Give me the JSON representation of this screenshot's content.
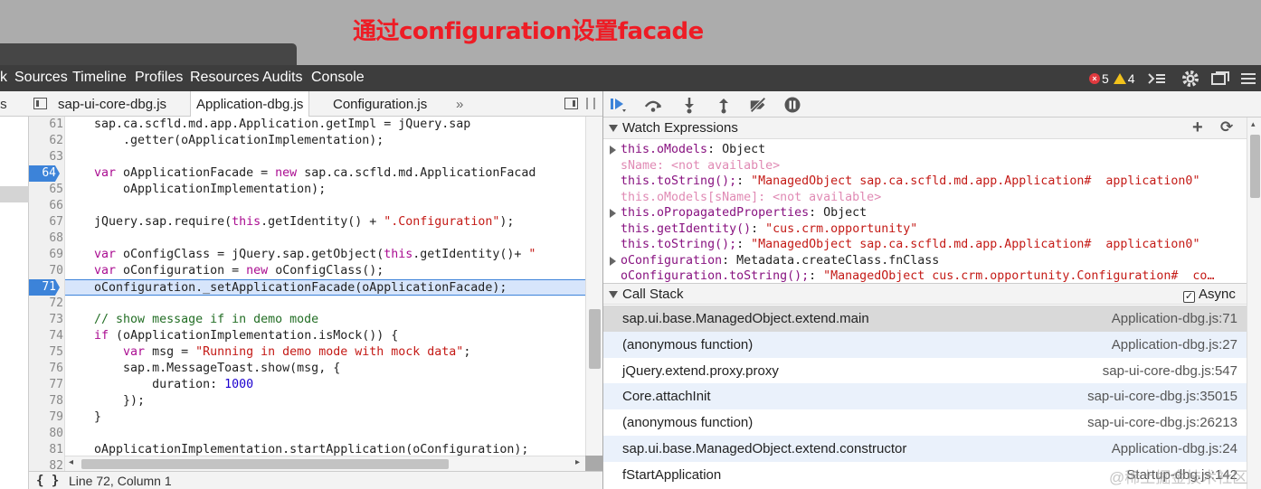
{
  "annotation": "通过configuration设置facade",
  "panel_tabs": [
    "k",
    "Sources",
    "Timeline",
    "Profiles",
    "Resources",
    "Audits",
    "Console"
  ],
  "counts": {
    "errors": "5",
    "warnings": "4"
  },
  "navigator": {
    "label": "ts"
  },
  "editor_tabs": [
    "sap-ui-core-dbg.js",
    "Application-dbg.js",
    "Configuration.js"
  ],
  "active_tab": "Application-dbg.js",
  "more_tabs": "»",
  "breakpoints": [
    "64",
    "71"
  ],
  "current_line": "71",
  "code_lines": [
    {
      "n": "61",
      "parts": [
        [
          "",
          "    sap.ca.scfld.md.app.Application.getImpl = jQuery.sap"
        ]
      ]
    },
    {
      "n": "62",
      "parts": [
        [
          "",
          "        .getter(oApplicationImplementation);"
        ]
      ]
    },
    {
      "n": "63",
      "parts": [
        [
          "",
          ""
        ]
      ]
    },
    {
      "n": "64",
      "parts": [
        [
          "kw",
          "    var"
        ],
        [
          "",
          " oApplicationFacade = "
        ],
        [
          "kw",
          "new"
        ],
        [
          "",
          " sap.ca.scfld.md.ApplicationFacad"
        ]
      ]
    },
    {
      "n": "65",
      "parts": [
        [
          "",
          "        oApplicationImplementation);"
        ]
      ]
    },
    {
      "n": "66",
      "parts": [
        [
          "",
          ""
        ]
      ]
    },
    {
      "n": "67",
      "parts": [
        [
          "",
          "    jQuery.sap.require("
        ],
        [
          "kw",
          "this"
        ],
        [
          "",
          ".getIdentity() + "
        ],
        [
          "str",
          "\".Configuration\""
        ],
        [
          "",
          ");"
        ]
      ]
    },
    {
      "n": "68",
      "parts": [
        [
          "",
          ""
        ]
      ]
    },
    {
      "n": "69",
      "parts": [
        [
          "kw",
          "    var"
        ],
        [
          "",
          " oConfigClass = jQuery.sap.getObject("
        ],
        [
          "kw",
          "this"
        ],
        [
          "",
          ".getIdentity()+ "
        ],
        [
          "str",
          "\""
        ]
      ]
    },
    {
      "n": "70",
      "parts": [
        [
          "kw",
          "    var"
        ],
        [
          "",
          " oConfiguration = "
        ],
        [
          "kw",
          "new"
        ],
        [
          "",
          " oConfigClass();"
        ]
      ]
    },
    {
      "n": "71",
      "parts": [
        [
          "",
          "    oConfiguration._setApplicationFacade(oApplicationFacade);"
        ]
      ]
    },
    {
      "n": "72",
      "parts": [
        [
          "",
          ""
        ]
      ]
    },
    {
      "n": "73",
      "parts": [
        [
          "cmt",
          "    // show message if in demo mode"
        ]
      ]
    },
    {
      "n": "74",
      "parts": [
        [
          "kw",
          "    if"
        ],
        [
          "",
          " (oApplicationImplementation.isMock()) {"
        ]
      ]
    },
    {
      "n": "75",
      "parts": [
        [
          "kw",
          "        var"
        ],
        [
          "",
          " msg = "
        ],
        [
          "str",
          "\"Running in demo mode with mock data\""
        ],
        [
          "",
          ";"
        ]
      ]
    },
    {
      "n": "76",
      "parts": [
        [
          "",
          "        sap.m.MessageToast.show(msg, {"
        ]
      ]
    },
    {
      "n": "77",
      "parts": [
        [
          "",
          "            duration: "
        ],
        [
          "num",
          "1000"
        ]
      ]
    },
    {
      "n": "78",
      "parts": [
        [
          "",
          "        });"
        ]
      ]
    },
    {
      "n": "79",
      "parts": [
        [
          "",
          "    }"
        ]
      ]
    },
    {
      "n": "80",
      "parts": [
        [
          "",
          ""
        ]
      ]
    },
    {
      "n": "81",
      "parts": [
        [
          "",
          "    oApplicationImplementation.startApplication(oConfiguration);"
        ]
      ]
    },
    {
      "n": "82",
      "parts": [
        [
          "",
          ""
        ]
      ]
    }
  ],
  "status": {
    "braces": "{ }",
    "position": "Line 72, Column 1"
  },
  "watch": {
    "title": "Watch Expressions",
    "items": [
      {
        "arrow": true,
        "parts": [
          [
            "wkey",
            "this.oModels"
          ],
          [
            "",
            ": Object"
          ]
        ]
      },
      {
        "arrow": false,
        "parts": [
          [
            "wna",
            "sName: <not available>"
          ]
        ]
      },
      {
        "arrow": false,
        "parts": [
          [
            "wkey",
            "this.toString();"
          ],
          [
            "",
            ": "
          ],
          [
            "wstr",
            "\"ManagedObject sap.ca.scfld.md.app.Application#  application0\""
          ]
        ]
      },
      {
        "arrow": false,
        "parts": [
          [
            "wna",
            "this.oModels[sName]: <not available>"
          ]
        ]
      },
      {
        "arrow": true,
        "parts": [
          [
            "wkey",
            "this.oPropagatedProperties"
          ],
          [
            "",
            ": Object"
          ]
        ]
      },
      {
        "arrow": false,
        "parts": [
          [
            "wkey",
            "this.getIdentity()"
          ],
          [
            "",
            ": "
          ],
          [
            "wstr",
            "\"cus.crm.opportunity\""
          ]
        ]
      },
      {
        "arrow": false,
        "parts": [
          [
            "wkey",
            "this.toString();"
          ],
          [
            "",
            ": "
          ],
          [
            "wstr",
            "\"ManagedObject sap.ca.scfld.md.app.Application#  application0\""
          ]
        ]
      },
      {
        "arrow": true,
        "parts": [
          [
            "wkey",
            "oConfiguration"
          ],
          [
            "",
            ": Metadata.createClass.fnClass"
          ]
        ]
      },
      {
        "arrow": false,
        "parts": [
          [
            "wkey",
            "oConfiguration.toString();"
          ],
          [
            "",
            ": "
          ],
          [
            "wstr",
            "\"ManagedObject cus.crm.opportunity.Configuration#  co…"
          ]
        ]
      }
    ]
  },
  "call_stack": {
    "title": "Call Stack",
    "async_label": "Async",
    "async_checked": "✓",
    "frames": [
      {
        "fn": "sap.ui.base.ManagedObject.extend.main",
        "loc": "Application-dbg.js:71"
      },
      {
        "fn": "(anonymous function)",
        "loc": "Application-dbg.js:27"
      },
      {
        "fn": "jQuery.extend.proxy.proxy",
        "loc": "sap-ui-core-dbg.js:547"
      },
      {
        "fn": "Core.attachInit",
        "loc": "sap-ui-core-dbg.js:35015"
      },
      {
        "fn": "(anonymous function)",
        "loc": "sap-ui-core-dbg.js:26213"
      },
      {
        "fn": "sap.ui.base.ManagedObject.extend.constructor",
        "loc": "Application-dbg.js:24"
      },
      {
        "fn": "fStartApplication",
        "loc": "Startup-dbg.js:142"
      }
    ]
  },
  "watermark": "@稀土掘金技术社区",
  "colors": {
    "breakpoint": "#3c83d9",
    "annotation": "#ee1c25",
    "current_line_bg": "#d7e5fb"
  },
  "icons": [
    "resume-icon",
    "step-over-icon",
    "step-into-icon",
    "step-out-icon",
    "deactivate-breakpoints-icon",
    "pause-on-exceptions-icon",
    "add-icon",
    "refresh-icon",
    "execute-icon",
    "gear-icon",
    "dock-icon",
    "more-icon"
  ]
}
